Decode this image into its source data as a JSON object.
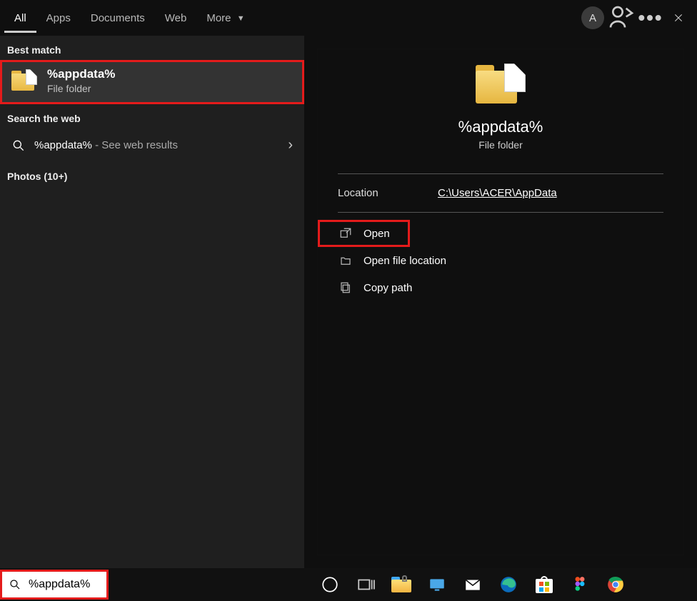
{
  "tabs": {
    "all": "All",
    "apps": "Apps",
    "documents": "Documents",
    "web": "Web",
    "more": "More"
  },
  "avatar_letter": "A",
  "sections": {
    "best_match": "Best match",
    "search_web": "Search the web",
    "photos": "Photos (10+)"
  },
  "best_match": {
    "title": "%appdata%",
    "subtitle": "File folder"
  },
  "web_result": {
    "query": "%appdata%",
    "suffix": " - See web results"
  },
  "preview": {
    "title": "%appdata%",
    "subtitle": "File folder",
    "location_label": "Location",
    "location_value": "C:\\Users\\ACER\\AppData"
  },
  "actions": {
    "open": "Open",
    "open_file_location": "Open file location",
    "copy_path": "Copy path"
  },
  "searchbox": {
    "query": "%appdata%"
  }
}
